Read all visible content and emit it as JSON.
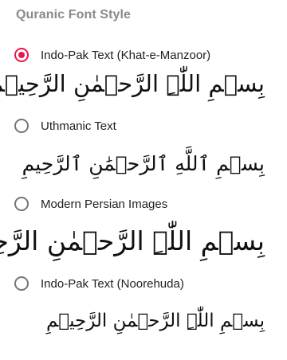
{
  "section_title": "Quranic Font Style",
  "accent_color": "#e8174f",
  "options": [
    {
      "label": "Indo-Pak Text (Khat-e-Manzoor)",
      "selected": true,
      "preview": "بِسۡمِ اللّٰہِ الرَّحۡمٰنِ الرَّحِیۡمِ"
    },
    {
      "label": "Uthmanic Text",
      "selected": false,
      "preview": "بِسۡمِ ٱللَّهِ ٱلرَّحۡمَٰنِ ٱلرَّحِيمِ"
    },
    {
      "label": "Modern Persian Images",
      "selected": false,
      "preview": "بِسۡمِ اللّٰہِ الرَّحۡمٰنِ الرَّحِیۡمِ"
    },
    {
      "label": "Indo-Pak Text (Noorehuda)",
      "selected": false,
      "preview": "بِسۡمِ اللّٰہِ الرَّحۡمٰنِ الرَّحِیۡمِ"
    }
  ]
}
